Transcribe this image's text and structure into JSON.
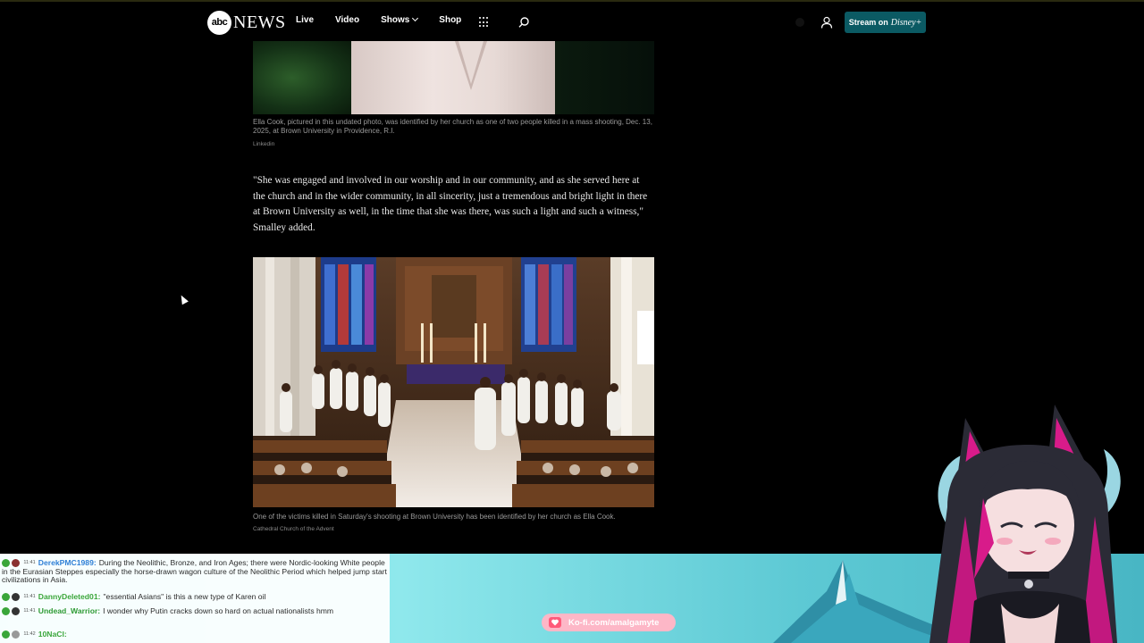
{
  "header": {
    "logo_abc": "abc",
    "logo_news": "NEWS",
    "nav": [
      {
        "label": "Live"
      },
      {
        "label": "Video"
      },
      {
        "label": "Shows"
      },
      {
        "label": "Shop"
      }
    ],
    "stream_prefix": "Stream on",
    "stream_brand": "Disney+"
  },
  "article": {
    "photo1_caption": "Ella Cook, pictured in this undated photo, was identified by her church as one of two people killed in a mass shooting, Dec. 13, 2025, at Brown University in Providence, R.I.",
    "photo1_credit": "Linkedin",
    "quote": "\"She was engaged and involved in our worship and in our community, and as she served here at the church and in the wider community, in all sincerity, just a tremendous and bright light in there at Brown University as well, in the time that she was there, was such a light and such a witness,\" Smalley added.",
    "photo2_caption": "One of the victims killed in Saturday's shooting at Brown University has been identified by her church as Ella Cook.",
    "photo2_credit": "Cathedral Church of the Advent"
  },
  "stream": {
    "chat": [
      {
        "time": "11:41",
        "user": "DerekPMC1989:",
        "user_color": "#2f7fd6",
        "message": "During the Neolithic, Bronze, and Iron Ages; there were Nordic-looking White people in the Eurasian Steppes especially the horse-drawn wagon culture of the Neolithic Period which helped jump start civilizations in Asia."
      },
      {
        "time": "11:41",
        "user": "DannyDeleted01:",
        "user_color": "#3aa63a",
        "message": "\"essential Asians\" is this a new type of Karen oil"
      },
      {
        "time": "11:41",
        "user": "Undead_Warrior:",
        "user_color": "#2e9a34",
        "message": "I wonder why Putin cracks down so hard on actual nationalists hmm"
      },
      {
        "time": "11:42",
        "user": "10NaCl:",
        "user_color": "#3aa63a",
        "message": ""
      }
    ],
    "kofi_label": "Ko-fi.com/amalgamyte"
  }
}
